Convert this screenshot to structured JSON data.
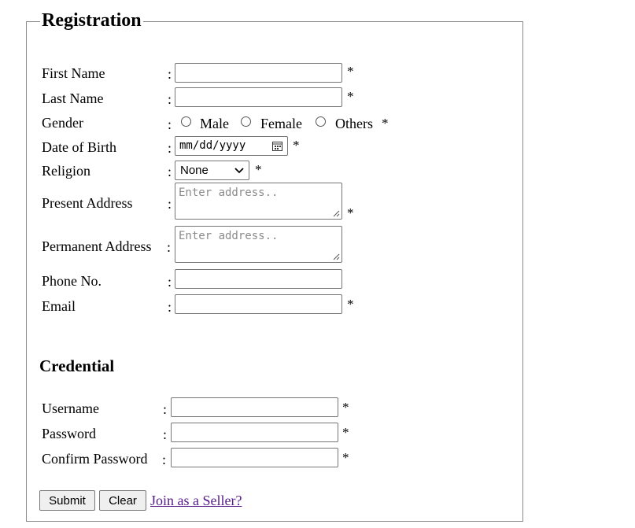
{
  "form": {
    "legend": "Registration",
    "required_marker": "*",
    "colon": ":",
    "fields": {
      "first_name": {
        "label": "First Name",
        "value": ""
      },
      "last_name": {
        "label": "Last Name",
        "value": ""
      },
      "gender": {
        "label": "Gender",
        "options": [
          "Male",
          "Female",
          "Others"
        ],
        "selected": ""
      },
      "dob": {
        "label": "Date of Birth",
        "value": "mm/dd/yyyy"
      },
      "religion": {
        "label": "Religion",
        "selected": "None"
      },
      "present_address": {
        "label": "Present Address",
        "placeholder": "Enter address.."
      },
      "permanent_address": {
        "label": "Permanent Address",
        "placeholder": "Enter address.."
      },
      "phone": {
        "label": "Phone No.",
        "value": ""
      },
      "email": {
        "label": "Email",
        "value": ""
      }
    },
    "credential": {
      "title": "Credential",
      "username": {
        "label": "Username",
        "value": ""
      },
      "password": {
        "label": "Password",
        "value": ""
      },
      "confirm_password": {
        "label": "Confirm Password",
        "value": ""
      }
    },
    "actions": {
      "submit": "Submit",
      "clear": "Clear",
      "seller_link": "Join as a Seller?"
    }
  }
}
